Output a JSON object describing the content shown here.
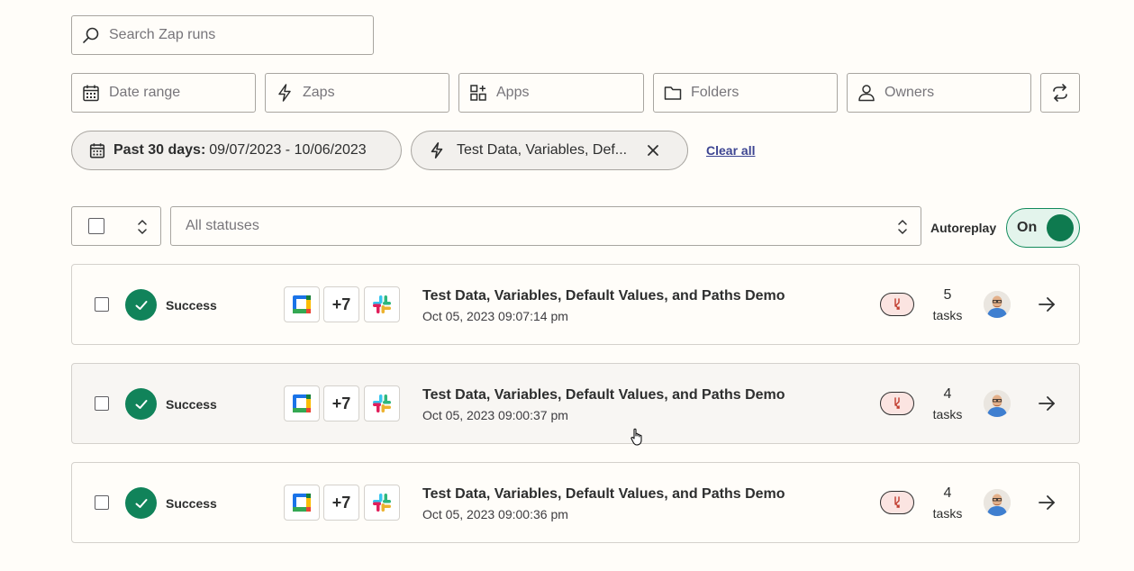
{
  "search": {
    "placeholder": "Search Zap runs"
  },
  "filters": [
    {
      "label": "Date range",
      "icon": "calendar-icon"
    },
    {
      "label": "Zaps",
      "icon": "lightning-icon"
    },
    {
      "label": "Apps",
      "icon": "apps-grid-icon"
    },
    {
      "label": "Folders",
      "icon": "folder-icon"
    },
    {
      "label": "Owners",
      "icon": "person-icon"
    }
  ],
  "sync_icon": "sync-icon",
  "active_filters": {
    "date_label": "Past 30 days:",
    "date_value": "09/07/2023 - 10/06/2023",
    "zap_value": "Test Data, Variables, Def...",
    "clear_all": "Clear all"
  },
  "status_select": {
    "value": "All statuses"
  },
  "autoreplay": {
    "label": "Autoreplay",
    "state": "On"
  },
  "runs": [
    {
      "status": "Success",
      "more_apps": "+7",
      "title": "Test Data, Variables, Default Values, and Paths Demo",
      "timestamp": "Oct 05, 2023 09:07:14 pm",
      "tasks": "5",
      "tasks_label": "tasks"
    },
    {
      "status": "Success",
      "more_apps": "+7",
      "title": "Test Data, Variables, Default Values, and Paths Demo",
      "timestamp": "Oct 05, 2023 09:00:37 pm",
      "tasks": "4",
      "tasks_label": "tasks"
    },
    {
      "status": "Success",
      "more_apps": "+7",
      "title": "Test Data, Variables, Default Values, and Paths Demo",
      "timestamp": "Oct 05, 2023 09:00:36 pm",
      "tasks": "4",
      "tasks_label": "tasks"
    }
  ],
  "colors": {
    "success": "#11835a",
    "toggle_on": "#0e7a4f",
    "link": "#3d4592",
    "path_badge": "#fbe4e1"
  }
}
